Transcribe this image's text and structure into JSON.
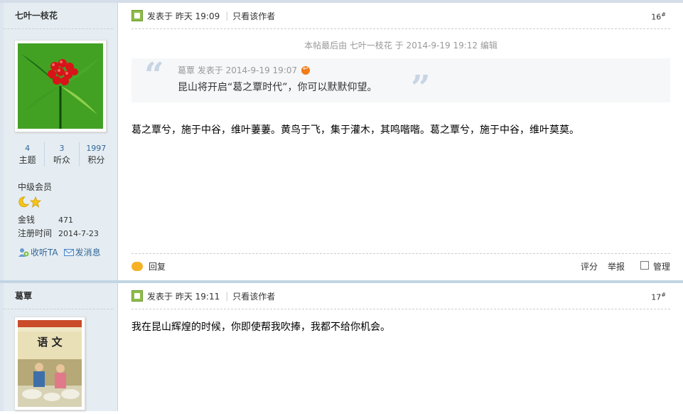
{
  "post1": {
    "author": "七叶一枝花",
    "stats": [
      {
        "num": "4",
        "label": "主题"
      },
      {
        "num": "3",
        "label": "听众"
      },
      {
        "num": "1997",
        "label": "积分"
      }
    ],
    "group": "中级会员",
    "money_label": "金钱",
    "money_value": "471",
    "reg_label": "注册时间",
    "reg_value": "2014-7-23",
    "follow_label": "收听TA",
    "message_label": "发消息",
    "posted": "发表于  昨天 19:09",
    "only_author": "只看该作者",
    "floor": "16",
    "edited": "本帖最后由 七叶一枝花 于 2014-9-19 19:12 编辑",
    "quote_meta": "葛覃 发表于 2014-9-19 19:07",
    "quote_text": "昆山将开启“葛之覃时代”，你可以默默仰望。",
    "body": "葛之覃兮，施于中谷，维叶萋萋。黄鸟于飞，集于灌木，其鸣喈喈。葛之覃兮，施于中谷，维叶莫莫。",
    "reply_label": "回复",
    "rate_label": "评分",
    "report_label": "举报",
    "manage_label": "管理"
  },
  "post2": {
    "author": "葛覃",
    "posted": "发表于  昨天 19:11",
    "only_author": "只看该作者",
    "floor": "17",
    "body": "我在昆山辉煌的时候，你即使帮我吹捧，我都不给你机会。",
    "cover_title": "语 文"
  },
  "colors": {
    "link": "#336699",
    "sidebar_bg": "#e5edf2",
    "accent_orange": "#f07c1a"
  }
}
